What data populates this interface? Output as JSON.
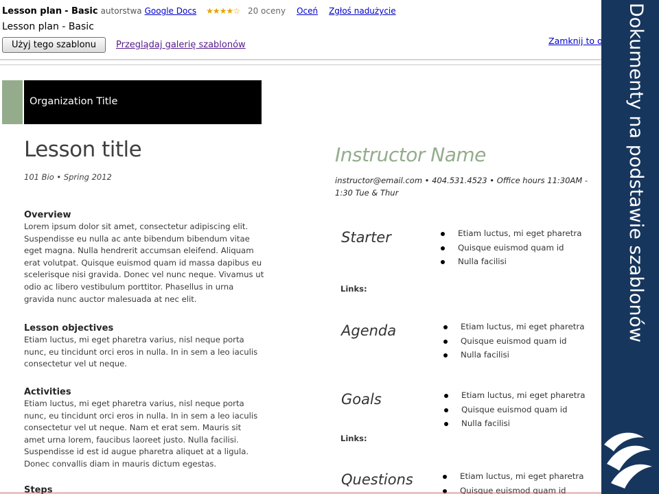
{
  "header": {
    "template_name": "Lesson plan",
    "template_variant": "- Basic",
    "author_label": "autorstwa",
    "author_link": "Google Docs",
    "stars_glyph": "★★★★☆",
    "rating_value": 4,
    "rating_max": 5,
    "rating_count": "20 oceny",
    "rate_link": "Oceń",
    "report_link": "Zgłoś nadużycie",
    "subtitle": "Lesson plan - Basic",
    "use_button": "Użyj tego szablonu",
    "gallery_link": "Przeglądaj galerię szablonów",
    "close_link": "Zamknij to okno"
  },
  "document": {
    "org_title": "Organization Title",
    "lesson_title": "Lesson title",
    "course_meta": "101 Bio • Spring 2012",
    "sections": {
      "overview": {
        "heading": "Overview",
        "body": "Lorem ipsum dolor sit amet, consectetur adipiscing elit. Suspendisse eu nulla ac ante bibendum bibendum vitae eget magna. Nulla hendrerit accumsan eleifend. Aliquam erat volutpat. Quisque euismod quam id massa dapibus eu scelerisque nisi gravida. Donec vel nunc neque. Vivamus ut odio ac libero vestibulum porttitor. Phasellus in urna gravida nunc auctor malesuada at nec elit."
      },
      "objectives": {
        "heading": "Lesson objectives",
        "body": "Etiam luctus, mi eget pharetra varius, nisl neque porta nunc, eu tincidunt orci eros in nulla. In in sem a leo iaculis consectetur vel ut neque."
      },
      "activities": {
        "heading": "Activities",
        "body": "Etiam luctus, mi eget pharetra varius, nisl neque porta nunc, eu tincidunt orci eros in nulla. In in sem a leo iaculis consectetur vel ut neque. Nam et erat sem. Mauris sit amet urna lorem, faucibus laoreet justo. Nulla facilisi. Suspendisse id est id augue pharetra aliquet at a ligula. Donec convallis diam in mauris dictum egestas."
      },
      "steps": {
        "heading": "Steps"
      }
    },
    "instructor": {
      "name": "Instructor Name",
      "meta": "instructor@email.com • 404.531.4523 • Office hours 11:30AM - 1:30 Tue & Thur"
    },
    "blocks": {
      "starter": {
        "title": "Starter",
        "links_label": "Links:",
        "items": [
          "Etiam luctus, mi eget pharetra",
          "Quisque euismod quam id",
          "Nulla facilisi"
        ]
      },
      "agenda": {
        "title": "Agenda",
        "items": [
          "Etiam luctus, mi eget pharetra",
          "Quisque euismod quam id",
          "Nulla facilisi"
        ]
      },
      "goals": {
        "title": "Goals",
        "links_label": "Links:",
        "items": [
          "Etiam luctus, mi eget pharetra",
          "Quisque euismod quam id",
          "Nulla facilisi"
        ]
      },
      "questions": {
        "title": "Questions",
        "items": [
          "Etiam luctus, mi eget pharetra",
          "Quisque euismod quam id"
        ]
      }
    }
  },
  "side_banner": {
    "text": "Dokumenty na podstawie szablonów",
    "icon": "logo-icon"
  },
  "colors": {
    "accent_green": "#94ac8c",
    "banner_blue": "#17365d",
    "link_blue": "#0000cc",
    "visited_purple": "#551a8b"
  }
}
